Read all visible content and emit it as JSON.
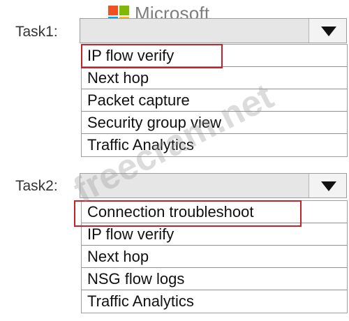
{
  "brand": {
    "name": "Microsoft",
    "logo_colors": [
      "#f25022",
      "#7fba00",
      "#00a4ef",
      "#ffb900"
    ]
  },
  "watermark": "freecram.net",
  "accent_color": "#c8202a",
  "tasks": [
    {
      "label": "Task1:",
      "selected_value": "",
      "options": [
        "IP flow verify",
        "Next hop",
        "Packet capture",
        "Security group view",
        "Traffic Analytics"
      ],
      "highlighted_option": "IP flow verify"
    },
    {
      "label": "Task2:",
      "selected_value": "",
      "options": [
        "Connection troubleshoot",
        "IP flow verify",
        "Next hop",
        "NSG flow logs",
        "Traffic Analytics"
      ],
      "highlighted_option": "Connection troubleshoot"
    }
  ]
}
